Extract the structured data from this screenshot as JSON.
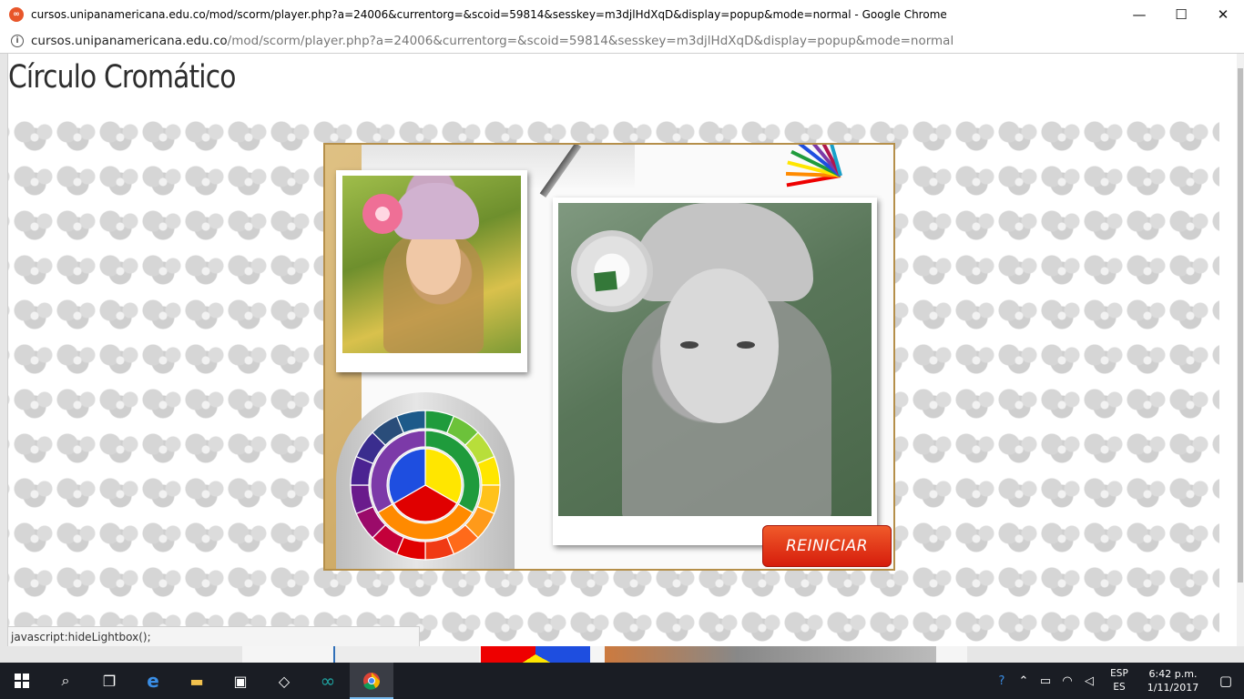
{
  "window": {
    "title": "cursos.unipanamericana.edu.co/mod/scorm/player.php?a=24006&currentorg=&scoid=59814&sesskey=m3djlHdXqD&display=popup&mode=normal - Google Chrome",
    "controls": {
      "minimize": "—",
      "maximize": "☐",
      "close": "✕"
    }
  },
  "address_bar": {
    "host": "cursos.unipanamericana.edu.co",
    "path": "/mod/scorm/player.php?a=24006&currentorg=&scoid=59814&sesskey=m3djlHdXqD&display=popup&mode=normal"
  },
  "page": {
    "title": "Círculo Cromático",
    "reset_button": "REINICIAR",
    "status_link": "javascript:hideLightbox();"
  },
  "colors": {
    "reset_button": "#e2330f",
    "board_wood": "#d6b674",
    "taskbar": "#1a1d24",
    "wheel": [
      "#1e4ee0",
      "#ffe600",
      "#e00000",
      "#7c3aa8",
      "#1f9b3c",
      "#ff8a00",
      "#b0164d",
      "#2a4d7a"
    ]
  },
  "icons": [
    "info-icon",
    "favicon-icon",
    "windows-start-icon",
    "search-icon",
    "task-view-icon",
    "edge-icon",
    "file-explorer-icon",
    "store-icon",
    "dropbox-icon",
    "arduino-icon",
    "chrome-icon",
    "help-icon",
    "chevron-up-icon",
    "battery-icon",
    "wifi-icon",
    "volume-icon",
    "notifications-icon"
  ],
  "taskbar": {
    "language": {
      "line1": "ESP",
      "line2": "ES"
    },
    "clock": {
      "time": "6:42 p.m.",
      "date": "1/11/2017"
    }
  }
}
